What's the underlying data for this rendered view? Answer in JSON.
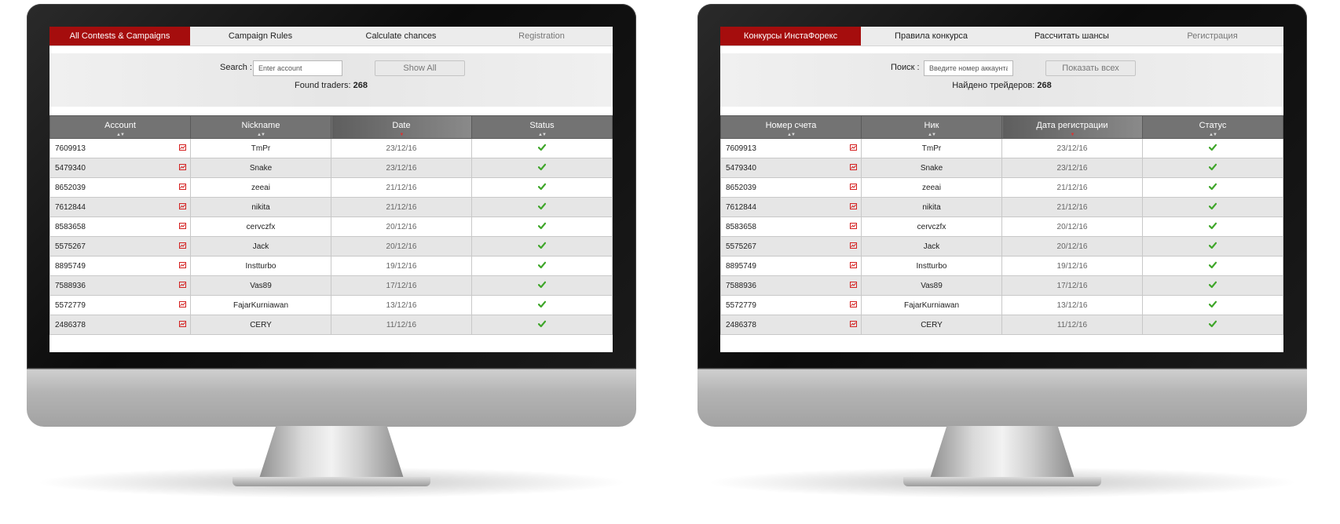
{
  "brand_color": "#a50d0d",
  "chart_icon": "chart-icon",
  "status_icon": "check-icon",
  "screens": [
    {
      "tabs": [
        "All Contests & Campaigns",
        "Campaign Rules",
        "Calculate chances",
        "Registration"
      ],
      "search_label": "Search :",
      "search_placeholder": "Enter account",
      "show_all": "Show All",
      "found_label": "Found traders:",
      "found_count": "268",
      "columns": [
        "Account",
        "Nickname",
        "Date",
        "Status"
      ],
      "rows": [
        {
          "account": "7609913",
          "nickname": "TmPr",
          "date": "23/12/16"
        },
        {
          "account": "5479340",
          "nickname": "Snake",
          "date": "23/12/16"
        },
        {
          "account": "8652039",
          "nickname": "zeeai",
          "date": "21/12/16"
        },
        {
          "account": "7612844",
          "nickname": "nikita",
          "date": "21/12/16"
        },
        {
          "account": "8583658",
          "nickname": "cervczfx",
          "date": "20/12/16"
        },
        {
          "account": "5575267",
          "nickname": "Jack",
          "date": "20/12/16"
        },
        {
          "account": "8895749",
          "nickname": "Instturbo",
          "date": "19/12/16"
        },
        {
          "account": "7588936",
          "nickname": "Vas89",
          "date": "17/12/16"
        },
        {
          "account": "5572779",
          "nickname": "FajarKurniawan",
          "date": "13/12/16"
        },
        {
          "account": "2486378",
          "nickname": "CERY",
          "date": "11/12/16"
        }
      ]
    },
    {
      "tabs": [
        "Конкурсы ИнстаФорекс",
        "Правила конкурса",
        "Рассчитать шансы",
        "Регистрация"
      ],
      "search_label": "Поиск :",
      "search_placeholder": "Введите номер аккаунта",
      "show_all": "Показать всех",
      "found_label": "Найдено трейдеров:",
      "found_count": "268",
      "columns": [
        "Номер счета",
        "Ник",
        "Дата регистрации",
        "Статус"
      ],
      "rows": [
        {
          "account": "7609913",
          "nickname": "TmPr",
          "date": "23/12/16"
        },
        {
          "account": "5479340",
          "nickname": "Snake",
          "date": "23/12/16"
        },
        {
          "account": "8652039",
          "nickname": "zeeai",
          "date": "21/12/16"
        },
        {
          "account": "7612844",
          "nickname": "nikita",
          "date": "21/12/16"
        },
        {
          "account": "8583658",
          "nickname": "cervczfx",
          "date": "20/12/16"
        },
        {
          "account": "5575267",
          "nickname": "Jack",
          "date": "20/12/16"
        },
        {
          "account": "8895749",
          "nickname": "Instturbo",
          "date": "19/12/16"
        },
        {
          "account": "7588936",
          "nickname": "Vas89",
          "date": "17/12/16"
        },
        {
          "account": "5572779",
          "nickname": "FajarKurniawan",
          "date": "13/12/16"
        },
        {
          "account": "2486378",
          "nickname": "CERY",
          "date": "11/12/16"
        }
      ]
    }
  ]
}
